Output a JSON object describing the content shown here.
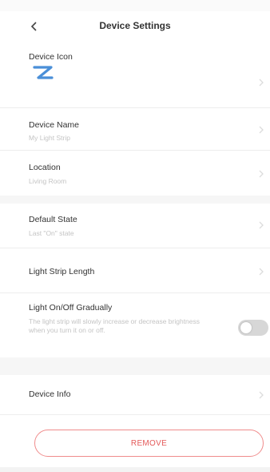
{
  "header": {
    "title": "Device Settings",
    "back_icon": "chevron-left-icon"
  },
  "device_icon_row": {
    "label": "Device Icon",
    "icon": "light-strip-icon",
    "icon_color": "#4a8fd8"
  },
  "device_name": {
    "label": "Device Name",
    "value": "My Light Strip"
  },
  "location": {
    "label": "Location",
    "value": "Living Room"
  },
  "default_state": {
    "label": "Default State",
    "value": "Last \"On\" state"
  },
  "light_strip_length": {
    "label": "Light Strip Length"
  },
  "gradual": {
    "label": "Light On/Off Gradually",
    "description": "The light strip will slowly increase or decrease brightness when you turn it on or off.",
    "enabled": false
  },
  "device_info": {
    "label": "Device Info"
  },
  "remove_button": {
    "label": "REMOVE",
    "color": "#e45a5a"
  }
}
